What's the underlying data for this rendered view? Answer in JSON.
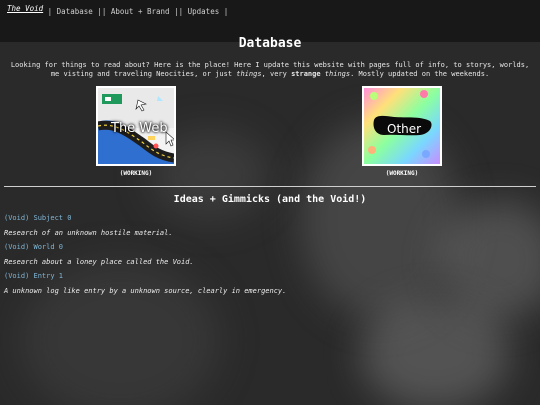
{
  "nav": {
    "logo": "The Void",
    "sep1": "|",
    "item1": "Database",
    "sep2": "||",
    "item2": "About + Brand",
    "sep3": "||",
    "item3": "Updates",
    "sep4": "|"
  },
  "page": {
    "title": "Database",
    "intro_part1": "Looking for things to read about? Here is the place! Here I update this website with pages full of info, to storys, worlds, me visting and traveling Neocities, or just ",
    "intro_things": "things",
    "intro_part2": ", very ",
    "intro_strange": "strange",
    "intro_space": " ",
    "intro_things2": "things",
    "intro_part3": ". Mostly updated on the weekends."
  },
  "cards": [
    {
      "thumb_text": "The Web",
      "caption": "(WORKING)"
    },
    {
      "thumb_text": "Other",
      "caption": "(WORKING)"
    }
  ],
  "section": {
    "title": "Ideas + Gimmicks (and the Void!)",
    "entries": [
      {
        "link": "(Void) Subject 0",
        "desc": "Research of an unknown hostile material."
      },
      {
        "link": "(Void) World 0",
        "desc": "Research about a loney place called the Void."
      },
      {
        "link": "(Void) Entry 1",
        "desc": "A unknown log like entry by a unknown source, clearly in emergency."
      }
    ]
  },
  "colors": {
    "background": "#2a2a2a",
    "topbar": "#181818",
    "link": "#7fb6d6",
    "text": "#e6e6e6"
  }
}
